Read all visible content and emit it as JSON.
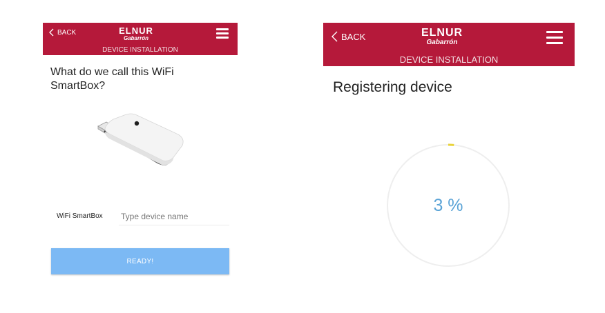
{
  "left": {
    "header": {
      "back_label": "BACK",
      "logo_line1": "ELNUR",
      "logo_line2": "Gabarrón",
      "subtitle": "DEVICE INSTALLATION"
    },
    "question": "What do we call this WiFi SmartBox?",
    "device_image_icon": "usb-wifi-smartbox-icon",
    "name_field": {
      "label": "WiFi SmartBox",
      "placeholder": "Type device name",
      "value": ""
    },
    "ready_button": "READY!"
  },
  "right": {
    "header": {
      "back_label": "BACK",
      "logo_line1": "ELNUR",
      "logo_line2": "Gabarrón",
      "subtitle": "DEVICE INSTALLATION"
    },
    "title": "Registering device",
    "progress": {
      "value": 3,
      "text": "3 %"
    }
  },
  "colors": {
    "header": "#b5193a",
    "button": "#7cb9f4",
    "progress_text": "#5aa3d6",
    "progress_arc": "#e9d33a",
    "ring": "#eeeeee"
  }
}
